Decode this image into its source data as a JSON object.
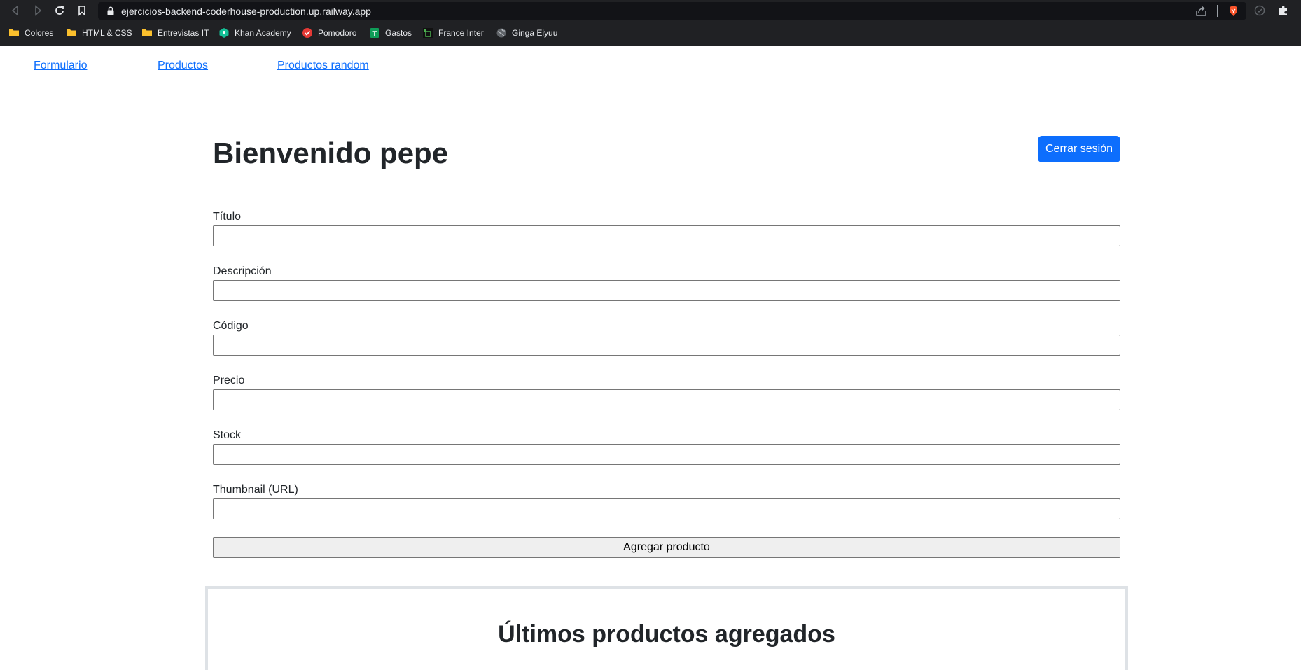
{
  "browser": {
    "url": "ejercicios-backend-coderhouse-production.up.railway.app",
    "bookmarks": [
      {
        "label": "Colores",
        "icon": "folder-icon"
      },
      {
        "label": "HTML & CSS",
        "icon": "folder-icon"
      },
      {
        "label": "Entrevistas IT",
        "icon": "folder-icon"
      },
      {
        "label": "Khan Academy",
        "icon": "khan-academy-icon"
      },
      {
        "label": "Pomodoro",
        "icon": "pomodoro-icon"
      },
      {
        "label": "Gastos",
        "icon": "sheets-icon"
      },
      {
        "label": "France Inter",
        "icon": "france-inter-icon"
      },
      {
        "label": "Ginga Eiyuu",
        "icon": "globe-icon"
      }
    ]
  },
  "nav": {
    "links": [
      "Formulario",
      "Productos",
      "Productos random"
    ]
  },
  "header": {
    "welcome": "Bienvenido pepe",
    "logout_label": "Cerrar sesión"
  },
  "form": {
    "fields": [
      {
        "label": "Título",
        "value": ""
      },
      {
        "label": "Descripción",
        "value": ""
      },
      {
        "label": "Código",
        "value": ""
      },
      {
        "label": "Precio",
        "value": ""
      },
      {
        "label": "Stock",
        "value": ""
      },
      {
        "label": "Thumbnail (URL)",
        "value": ""
      }
    ],
    "submit_label": "Agregar producto"
  },
  "products": {
    "title": "Últimos productos agregados"
  },
  "colors": {
    "primary": "#0d6efd",
    "chrome_bg": "#202124",
    "text": "#212529"
  }
}
